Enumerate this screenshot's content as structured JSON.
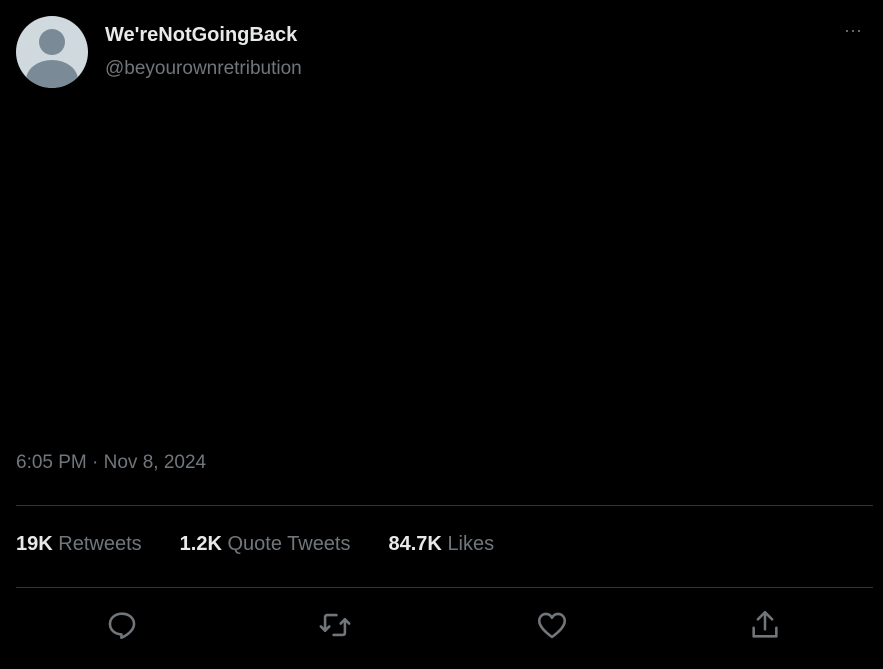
{
  "author": {
    "display_name": "We'reNotGoingBack",
    "handle": "@beyourownretribution"
  },
  "tweet": {
    "text": ""
  },
  "timestamp": "6:05 PM · Nov 8, 2024",
  "stats": {
    "retweets_count": "19K",
    "retweets_label": "Retweets",
    "quotes_count": "1.2K",
    "quotes_label": "Quote Tweets",
    "likes_count": "84.7K",
    "likes_label": "Likes"
  },
  "icons": {
    "more": "more-horizontal-icon",
    "reply": "reply-icon",
    "retweet": "retweet-icon",
    "like": "heart-icon",
    "share": "share-icon"
  },
  "colors": {
    "background": "#000000",
    "primary_text": "#e7e9ea",
    "secondary_text": "#71767b",
    "divider": "#2f3336"
  },
  "more_glyph": "···"
}
